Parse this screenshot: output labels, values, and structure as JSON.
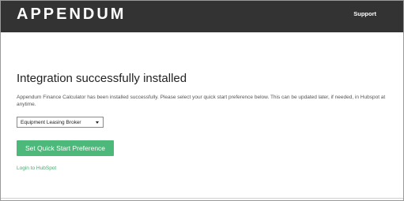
{
  "header": {
    "logo_text": "APPENDUM",
    "support_label": "Support"
  },
  "main": {
    "title": "Integration successfully installed",
    "description": "Appendum Finance Calculator has been installed successfully. Please select your quick start preference below. This can be updated later, if needed, in Hubspot at anytime.",
    "preference_select": {
      "selected": "Equipment Leasing Broker"
    },
    "submit_label": "Set Quick Start Preference",
    "login_link": "Login to HubSpot"
  },
  "colors": {
    "topbar": "#333333",
    "primary_button": "#4cb87a",
    "link": "#4aa870"
  }
}
